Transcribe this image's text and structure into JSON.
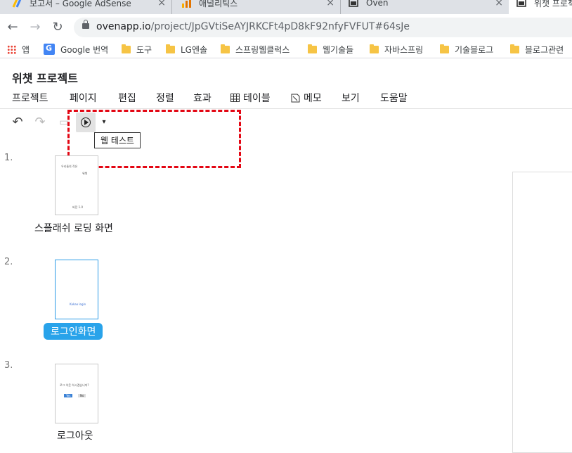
{
  "tabs": [
    {
      "title": "보고서 – Google AdSense",
      "icon": "adsense-icon",
      "close": "×"
    },
    {
      "title": "애널리틱스",
      "icon": "analytics-icon",
      "close": "×"
    },
    {
      "title": "Oven",
      "icon": "oven-icon",
      "close": "×"
    },
    {
      "title": "위챗 프로젝트",
      "icon": "oven-icon"
    }
  ],
  "nav": {
    "back_icon": "←",
    "forward_icon": "→",
    "reload_icon": "↻",
    "url_host": "ovenapp.io",
    "url_path": "/project/JpGVtiSeAYJRKCFt4pD8kF92nfyFVFUT#64sJe"
  },
  "bookmarks": [
    {
      "label": "앱",
      "icon": "apps-grid-icon"
    },
    {
      "label": "Google 번역",
      "icon": "google-translate-icon"
    },
    {
      "label": "도구",
      "icon": "folder-icon"
    },
    {
      "label": "LG엔솔",
      "icon": "folder-icon"
    },
    {
      "label": "스프링웹클럭스",
      "icon": "folder-icon"
    },
    {
      "label": "웹기술들",
      "icon": "folder-icon"
    },
    {
      "label": "자바스프링",
      "icon": "folder-icon"
    },
    {
      "label": "기술블로그",
      "icon": "folder-icon"
    },
    {
      "label": "블로그관련",
      "icon": "folder-icon"
    }
  ],
  "app": {
    "title": "위챗 프로젝트",
    "menu": [
      "프로젝트",
      "페이지",
      "편집",
      "정렬",
      "효과",
      "테이블",
      "메모",
      "보기",
      "도움말"
    ],
    "toolbar": {
      "undo_icon": "↶",
      "redo_icon": "↷",
      "card_icon": "▭",
      "dropdown_icon": "▾"
    },
    "tooltip": "웹 테스트"
  },
  "slides": [
    {
      "number": "1.",
      "label": "스플래쉬 로딩 화면",
      "selected": false,
      "mini_text_a": "우리들의 작은",
      "mini_text_b": "위챗",
      "mini_text_c": "버전 1.0"
    },
    {
      "number": "2.",
      "label": "로그인화면",
      "selected": true,
      "mini_text_a": "Kakao login"
    },
    {
      "number": "3.",
      "label": "로그아웃",
      "selected": false,
      "mini_text_a": "로그 아웃 하시겠습니까?",
      "mini_btn_a": "Yes",
      "mini_btn_b": "No"
    }
  ],
  "colors": {
    "highlight": "#e30613",
    "selected": "#29a3ea"
  }
}
